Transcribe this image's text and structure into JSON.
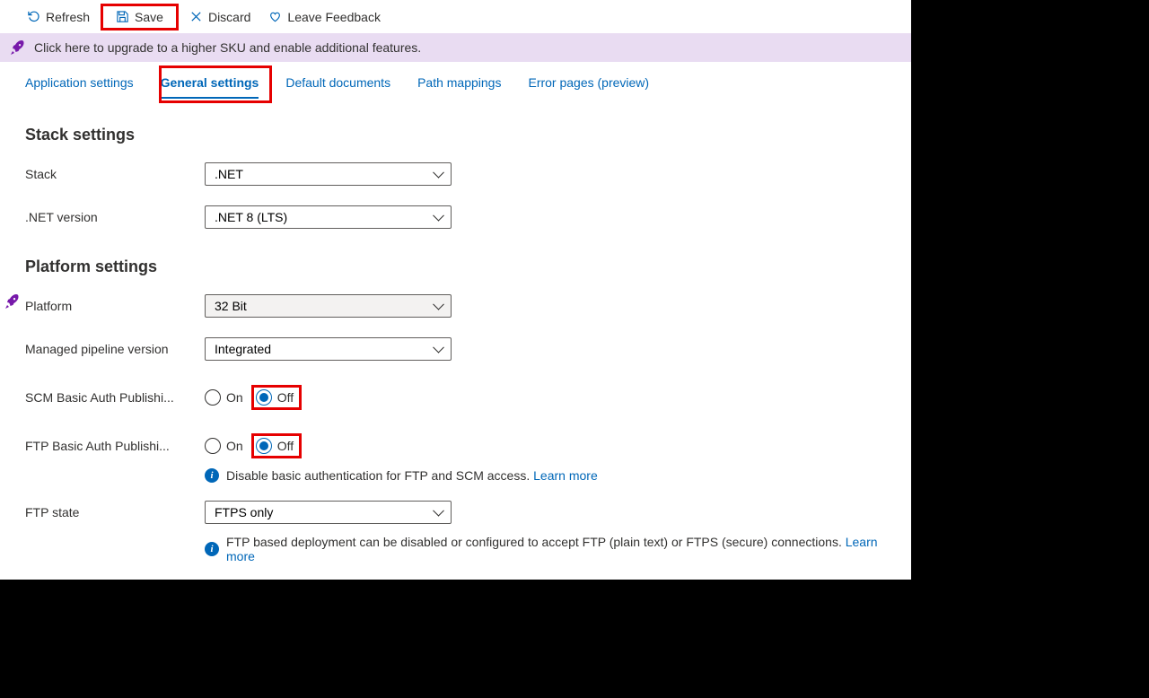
{
  "toolbar": {
    "refresh": "Refresh",
    "save": "Save",
    "discard": "Discard",
    "feedback": "Leave Feedback"
  },
  "banner": "Click here to upgrade to a higher SKU and enable additional features.",
  "tabs": {
    "app_settings": "Application settings",
    "general": "General settings",
    "default_docs": "Default documents",
    "path_mappings": "Path mappings",
    "error_pages": "Error pages (preview)"
  },
  "sections": {
    "stack": "Stack settings",
    "platform": "Platform settings"
  },
  "fields": {
    "stack": {
      "label": "Stack",
      "value": ".NET"
    },
    "netversion": {
      "label": ".NET version",
      "value": ".NET 8 (LTS)"
    },
    "platform": {
      "label": "Platform",
      "value": "32 Bit"
    },
    "pipeline": {
      "label": "Managed pipeline version",
      "value": "Integrated"
    },
    "scm": {
      "label": "SCM Basic Auth Publishi..."
    },
    "ftp": {
      "label": "FTP Basic Auth Publishi..."
    },
    "ftpstate": {
      "label": "FTP state",
      "value": "FTPS only"
    }
  },
  "radio": {
    "on": "On",
    "off": "Off"
  },
  "info": {
    "basicauth": "Disable basic authentication for FTP and SCM access.",
    "ftpstate": "FTP based deployment can be disabled or configured to accept FTP (plain text) or FTPS (secure) connections.",
    "learnmore": "Learn more"
  }
}
